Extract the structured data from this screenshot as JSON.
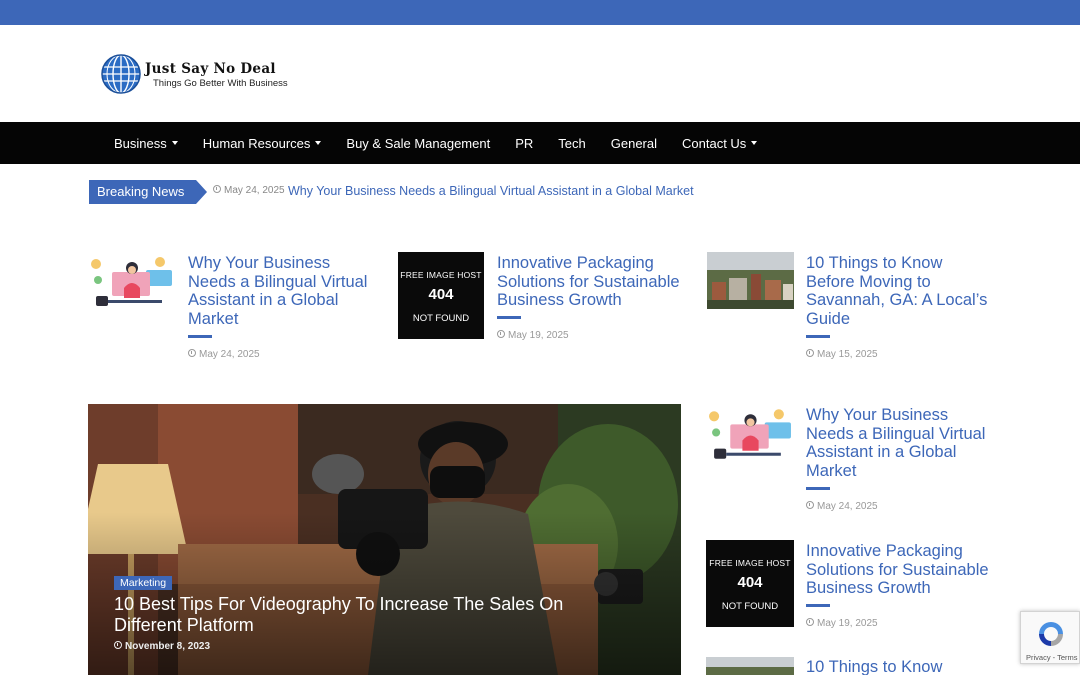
{
  "site": {
    "name": "Just Say No Deal",
    "tagline": "Things Go Better With Business"
  },
  "nav": {
    "items": [
      {
        "label": "Business",
        "dropdown": true
      },
      {
        "label": "Human Resources",
        "dropdown": true
      },
      {
        "label": "Buy & Sale Management",
        "dropdown": false
      },
      {
        "label": "PR",
        "dropdown": false
      },
      {
        "label": "Tech",
        "dropdown": false
      },
      {
        "label": "General",
        "dropdown": false
      },
      {
        "label": "Contact Us",
        "dropdown": true
      }
    ]
  },
  "breaking": {
    "label": "Breaking News",
    "date": "May 24, 2025",
    "headline": "Why Your Business Needs a Bilingual Virtual Assistant in a Global Market"
  },
  "top_posts": [
    {
      "title": "Why Your Business Needs a Bilingual Virtual Assistant in a Global Market",
      "date": "May 24, 2025"
    },
    {
      "title": "Innovative Packaging Solutions for Sustainable Business Growth",
      "date": "May 19, 2025"
    },
    {
      "title": "10 Things to Know Before Moving to Savannah, GA: A Local’s Guide",
      "date": "May 15, 2025"
    }
  ],
  "placeholder_image": {
    "line1": "FREE IMAGE HOST",
    "line2": "404",
    "line3": "NOT FOUND"
  },
  "feature": {
    "category": "Marketing",
    "title": "10 Best Tips For Videography To Increase The Sales On Different Platform",
    "date": "November 8, 2023"
  },
  "sidebar_posts": [
    {
      "title": "Why Your Business Needs a Bilingual Virtual Assistant in a Global Market",
      "date": "May 24, 2025"
    },
    {
      "title": "Innovative Packaging Solutions for Sustainable Business Growth",
      "date": "May 19, 2025"
    },
    {
      "title": "10 Things to Know",
      "date": ""
    }
  ],
  "recaptcha": {
    "text": "Privacy - Terms"
  },
  "colors": {
    "accent": "#3d67b8",
    "nav_background": "#050505",
    "top_bar": "#3d67b8"
  }
}
